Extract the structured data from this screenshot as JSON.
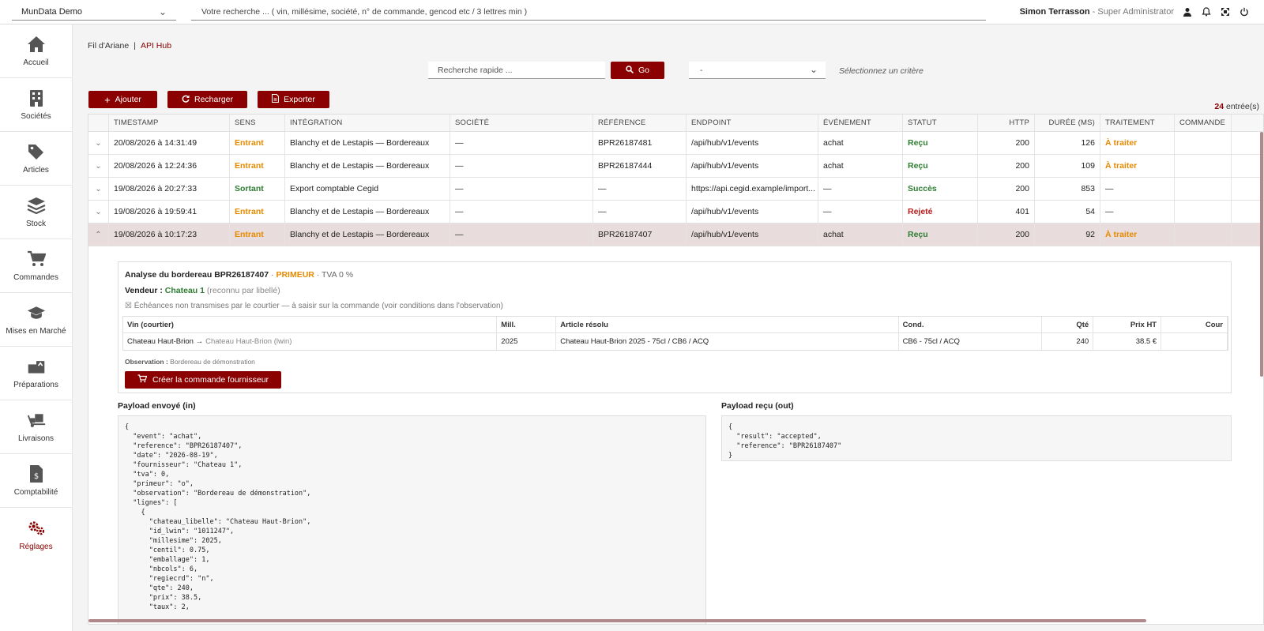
{
  "topbar": {
    "company": "MunData Demo",
    "search_placeholder": "Votre recherche ... ( vin, millésime, société, n° de commande, gencod etc / 3 lettres min )",
    "user_name": "Simon Terrasson",
    "user_role": "- Super Administrator"
  },
  "sidebar": {
    "items": [
      {
        "label": "Accueil",
        "icon": "home-icon"
      },
      {
        "label": "Sociétés",
        "icon": "building-icon"
      },
      {
        "label": "Articles",
        "icon": "tags-icon"
      },
      {
        "label": "Stock",
        "icon": "layers-icon"
      },
      {
        "label": "Commandes",
        "icon": "cart-icon"
      },
      {
        "label": "Mises en Marché",
        "icon": "graduation-cap-icon"
      },
      {
        "label": "Préparations",
        "icon": "boxes-icon"
      },
      {
        "label": "Livraisons",
        "icon": "dolly-icon"
      },
      {
        "label": "Comptabilité",
        "icon": "invoice-icon"
      },
      {
        "label": "Réglages",
        "icon": "cogs-icon"
      }
    ]
  },
  "breadcrumb": {
    "root": "Fil d'Ariane",
    "separator": "|",
    "current": "API Hub"
  },
  "filters": {
    "quick_search_placeholder": "Recherche rapide ...",
    "go_label": "Go",
    "criteria_value": "-",
    "criteria_hint": "Sélectionnez un critère"
  },
  "actions": {
    "add": "Ajouter",
    "reload": "Recharger",
    "export": "Exporter"
  },
  "entries": {
    "count": "24",
    "label": "entrée(s)"
  },
  "table": {
    "columns": [
      "TIMESTAMP",
      "SENS",
      "INTÉGRATION",
      "SOCIÉTÉ",
      "RÉFÉRENCE",
      "ENDPOINT",
      "ÉVÉNEMENT",
      "STATUT",
      "HTTP",
      "DURÉE (MS)",
      "TRAITEMENT",
      "COMMANDE"
    ],
    "rows": [
      {
        "timestamp": "20/08/2026 à 14:31:49",
        "sens": "Entrant",
        "integration": "Blanchy et de Lestapis — Bordereaux",
        "societe": "—",
        "reference": "BPR26187481",
        "endpoint": "/api/hub/v1/events",
        "evenement": "achat",
        "statut": "Reçu",
        "http": "200",
        "duree": "126",
        "traitement": "À traiter",
        "commande": ""
      },
      {
        "timestamp": "20/08/2026 à 12:24:36",
        "sens": "Entrant",
        "integration": "Blanchy et de Lestapis — Bordereaux",
        "societe": "—",
        "reference": "BPR26187444",
        "endpoint": "/api/hub/v1/events",
        "evenement": "achat",
        "statut": "Reçu",
        "http": "200",
        "duree": "109",
        "traitement": "À traiter",
        "commande": ""
      },
      {
        "timestamp": "19/08/2026 à 20:27:33",
        "sens": "Sortant",
        "integration": "Export comptable Cegid",
        "societe": "—",
        "reference": "—",
        "endpoint": "https://api.cegid.example/import...",
        "evenement": "—",
        "statut": "Succès",
        "http": "200",
        "duree": "853",
        "traitement": "—",
        "commande": ""
      },
      {
        "timestamp": "19/08/2026 à 19:59:41",
        "sens": "Entrant",
        "integration": "Blanchy et de Lestapis — Bordereaux",
        "societe": "—",
        "reference": "—",
        "endpoint": "/api/hub/v1/events",
        "evenement": "—",
        "statut": "Rejeté",
        "http": "401",
        "duree": "54",
        "traitement": "—",
        "commande": ""
      },
      {
        "timestamp": "19/08/2026 à 10:17:23",
        "sens": "Entrant",
        "integration": "Blanchy et de Lestapis — Bordereaux",
        "societe": "—",
        "reference": "BPR26187407",
        "endpoint": "/api/hub/v1/events",
        "evenement": "achat",
        "statut": "Reçu",
        "http": "200",
        "duree": "92",
        "traitement": "À traiter",
        "commande": ""
      }
    ]
  },
  "detail": {
    "title": "Analyse du bordereau BPR26187407",
    "primeur": "PRIMEUR",
    "tva": "TVA 0 %",
    "vendeur_label": "Vendeur :",
    "vendeur_name": "Chateau 1",
    "vendeur_note": "(reconnu par libellé)",
    "warning": "Échéances non transmises par le courtier — à saisir sur la commande (voir conditions dans l'observation)",
    "lines_columns": [
      "Vin (courtier)",
      "Mill.",
      "Article résolu",
      "Cond.",
      "Qté",
      "Prix HT",
      "Cour"
    ],
    "lines": [
      {
        "vin": "Chateau Haut-Brion →",
        "vin_alt": "Chateau Haut-Brion (lwin)",
        "mill": "2025",
        "article": "Chateau Haut-Brion 2025 - 75cl / CB6 / ACQ",
        "cond": "CB6 - 75cl / ACQ",
        "qte": "240",
        "prix": "38.5 €",
        "cour": ""
      }
    ],
    "observation_label": "Observation :",
    "observation_value": "Bordereau de démonstration",
    "create_button": "Créer la commande fournisseur",
    "payload_in_label": "Payload envoyé (in)",
    "payload_out_label": "Payload reçu (out)",
    "payload_in": "{\n  \"event\": \"achat\",\n  \"reference\": \"BPR26187407\",\n  \"date\": \"2026-08-19\",\n  \"fournisseur\": \"Chateau 1\",\n  \"tva\": 0,\n  \"primeur\": \"o\",\n  \"observation\": \"Bordereau de démonstration\",\n  \"lignes\": [\n    {\n      \"chateau_libelle\": \"Chateau Haut-Brion\",\n      \"id_lwin\": \"1011247\",\n      \"millesime\": 2025,\n      \"centil\": 0.75,\n      \"emballage\": 1,\n      \"nbcols\": 6,\n      \"regiecrd\": \"n\",\n      \"qte\": 240,\n      \"prix\": 38.5,\n      \"taux\": 2,",
    "payload_out": "{\n  \"result\": \"accepted\",\n  \"reference\": \"BPR26187407\"\n}"
  },
  "colors": {
    "accent": "#8b0000",
    "entrant": "#e68a00",
    "sortant": "#2e7d32",
    "rejete": "#b71c1c"
  }
}
